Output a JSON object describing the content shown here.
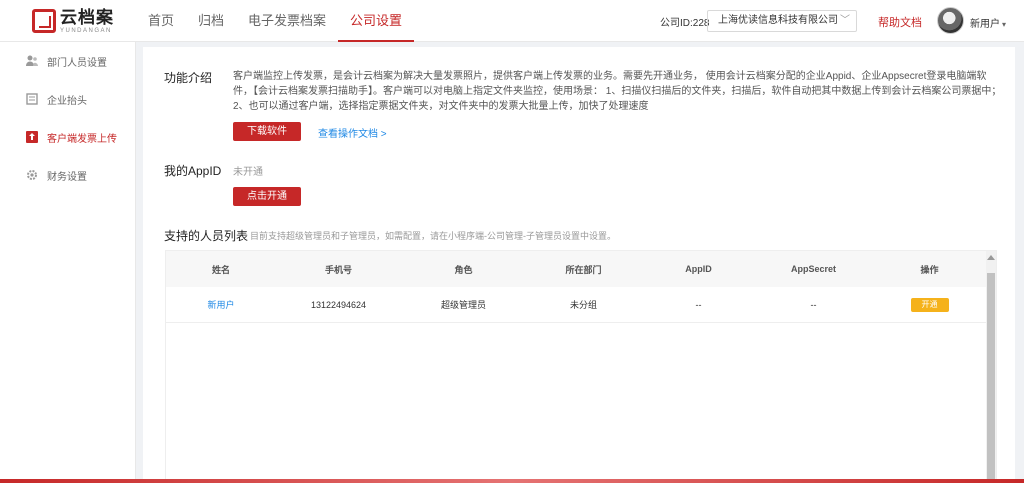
{
  "header": {
    "logo_cn": "云档案",
    "logo_en": "YUNDANGAN",
    "nav": [
      {
        "label": "首页"
      },
      {
        "label": "归档"
      },
      {
        "label": "电子发票档案"
      },
      {
        "label": "公司设置"
      }
    ],
    "company_id": "公司ID:228",
    "company_name": "上海优读信息科技有限公司",
    "help": "帮助文档",
    "username": "新用户"
  },
  "sidebar": {
    "items": [
      {
        "label": "部门人员设置"
      },
      {
        "label": "企业抬头"
      },
      {
        "label": "客户端发票上传"
      },
      {
        "label": "财务设置"
      }
    ]
  },
  "main": {
    "intro_label": "功能介绍",
    "intro_text": "客户端监控上传发票，是会计云档案为解决大量发票照片，提供客户端上传发票的业务。需要先开通业务， 使用会计云档案分配的企业Appid、企业Appsecret登录电脑端软件，【会计云档案发票扫描助手】。客户端可以对电脑上指定文件夹监控，使用场景： 1、扫描仪扫描后的文件夹，扫描后，软件自动把其中数据上传到会计云档案公司票据中； 2、也可以通过客户端，选择指定票据文件夹，对文件夹中的发票大批量上传，加快了处理速度",
    "download_btn": "下载软件",
    "doc_link": "查看操作文档 >",
    "appid_label": "我的AppID",
    "appid_value": "未开通",
    "open_btn": "点击开通",
    "list_label": "支持的人员列表",
    "list_hint": "目前支持超级管理员和子管理员，如需配置，请在小程序端-公司管理-子管理员设置中设置。"
  },
  "table": {
    "headers": [
      "姓名",
      "手机号",
      "角色",
      "所在部门",
      "AppID",
      "AppSecret",
      "操作"
    ],
    "rows": [
      {
        "name": "新用户",
        "phone": "13122494624",
        "role": "超级管理员",
        "dept": "未分组",
        "appid": "--",
        "appsecret": "--",
        "action": "开通"
      }
    ]
  },
  "colors": {
    "accent": "#c62828",
    "link": "#1e88e5",
    "action": "#f5b21b"
  }
}
